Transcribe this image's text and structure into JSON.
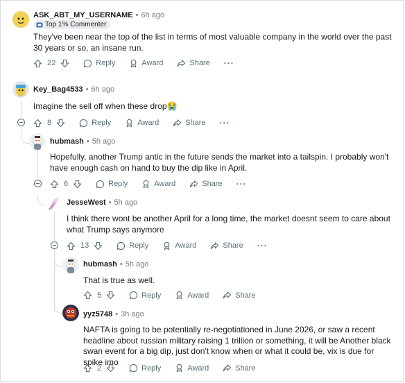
{
  "comments": [
    {
      "username": "ASK_ABT_MY_USERNAME",
      "time": "6h ago",
      "flair": "Top 1% Commenter",
      "body": "They've been near the top of the list in terms of most valuable company in the world over the past 30 years or so, an insane run.",
      "votes": "22"
    },
    {
      "username": "Key_Bag4533",
      "time": "6h ago",
      "body": "Imagine the sell off when these drop😭",
      "votes": "8"
    },
    {
      "username": "hubmash",
      "time": "5h ago",
      "body": "Hopefully, another Trump antic in the future sends the market into a tailspin. I probably won't have enough cash on hand to buy the dip like in April.",
      "votes": "6"
    },
    {
      "username": "JesseWest",
      "time": "5h ago",
      "body": "I think there wont be another April for a long time, the market doesnt seem to care about what Trump says anymore",
      "votes": "13"
    },
    {
      "username": "hubmash",
      "time": "5h ago",
      "body": "That is true as well.",
      "votes": "5"
    },
    {
      "username": "yyz5748",
      "time": "3h ago",
      "body": "NAFTA is going to be potentially re-negotiationed in June 2026, or saw a recent headline about russian military raising 1 trillion or something, it will be Another black swan event for a big dip, just don't know when or what it could be, vix is due for spike imo",
      "votes": "2"
    }
  ],
  "labels": {
    "reply": "Reply",
    "award": "Award",
    "share": "Share",
    "more": "···",
    "separator": "•"
  },
  "icons": [
    "upvote-icon",
    "downvote-icon",
    "reply-icon",
    "award-icon",
    "share-icon",
    "overflow-icon",
    "collapse-icon",
    "flair-icon"
  ]
}
